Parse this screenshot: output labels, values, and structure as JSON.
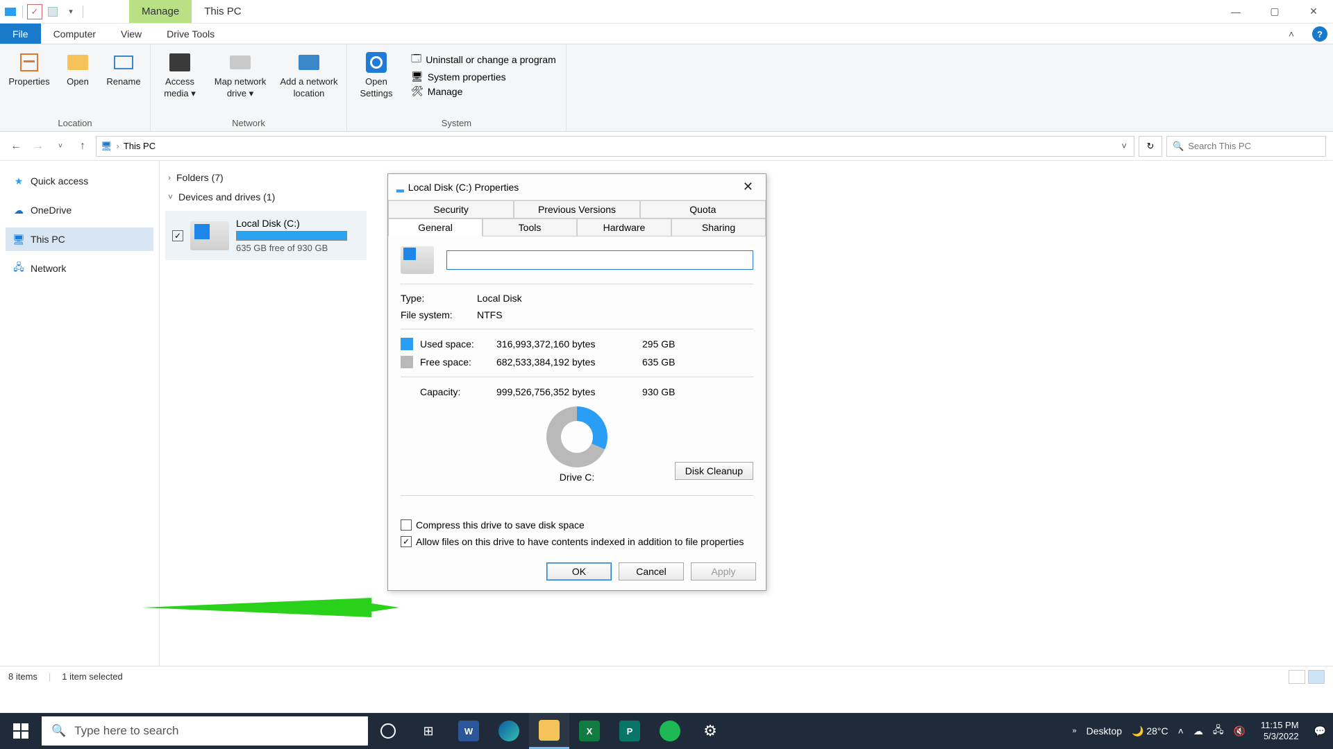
{
  "titlebar": {
    "manage": "Manage",
    "subtitle": "This PC"
  },
  "ribbonTabs": {
    "file": "File",
    "computer": "Computer",
    "view": "View",
    "driveTools": "Drive Tools"
  },
  "ribbon": {
    "properties": "Properties",
    "open": "Open",
    "rename": "Rename",
    "accessMedia1": "Access",
    "accessMedia2": "media ▾",
    "mapDrive1": "Map network",
    "mapDrive2": "drive ▾",
    "addLocation1": "Add a network",
    "addLocation2": "location",
    "openSettings1": "Open",
    "openSettings2": "Settings",
    "uninstall": "Uninstall or change a program",
    "sysprops": "System properties",
    "manage": "Manage",
    "group_location": "Location",
    "group_network": "Network",
    "group_system": "System"
  },
  "address": {
    "thisPC": "This PC",
    "searchPlaceholder": "Search This PC"
  },
  "sidebar": {
    "quickAccess": "Quick access",
    "oneDrive": "OneDrive",
    "thisPC": "This PC",
    "network": "Network"
  },
  "content": {
    "folders": "Folders (7)",
    "devices": "Devices and drives (1)",
    "driveName": "Local Disk (C:)",
    "driveFree": "635 GB free of 930 GB"
  },
  "status": {
    "items": "8 items",
    "selected": "1 item selected"
  },
  "dialog": {
    "title": "Local Disk (C:) Properties",
    "tab_security": "Security",
    "tab_prev": "Previous Versions",
    "tab_quota": "Quota",
    "tab_general": "General",
    "tab_tools": "Tools",
    "tab_hardware": "Hardware",
    "tab_sharing": "Sharing",
    "type_k": "Type:",
    "type_v": "Local Disk",
    "fs_k": "File system:",
    "fs_v": "NTFS",
    "used_lbl": "Used space:",
    "used_bytes": "316,993,372,160 bytes",
    "used_gb": "295 GB",
    "free_lbl": "Free space:",
    "free_bytes": "682,533,384,192 bytes",
    "free_gb": "635 GB",
    "cap_lbl": "Capacity:",
    "cap_bytes": "999,526,756,352 bytes",
    "cap_gb": "930 GB",
    "driveC": "Drive C:",
    "cleanup": "Disk Cleanup",
    "ck_compress": "Compress this drive to save disk space",
    "ck_index": "Allow files on this drive to have contents indexed in addition to file properties",
    "ok": "OK",
    "cancel": "Cancel",
    "apply": "Apply",
    "nameValue": ""
  },
  "taskbar": {
    "searchPlaceholder": "Type here to search",
    "desktop": "Desktop",
    "temp": "28°C",
    "time": "11:15 PM",
    "date": "5/3/2022"
  },
  "colors": {
    "used": "#2a9df4",
    "free": "#b9b9b9"
  }
}
